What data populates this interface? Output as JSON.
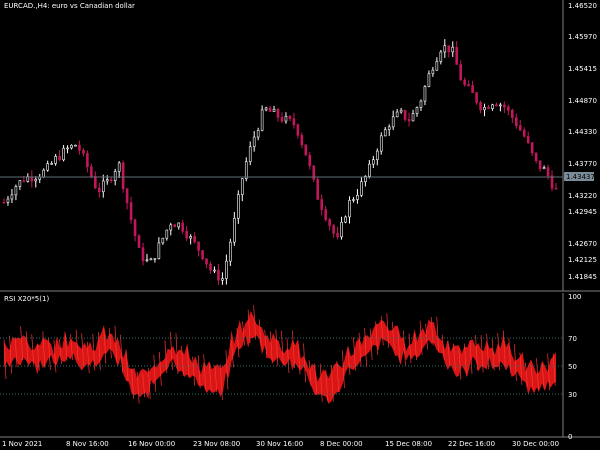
{
  "window": {
    "symbol_title": "EURCAD.,H4:  euro vs Canadian dollar",
    "indicator_title": "RSI X20*5(1)"
  },
  "colors": {
    "background": "#000000",
    "candle": "#ffffff",
    "candle_alt": "#c2185b",
    "axis_text": "#ffffff",
    "separator": "#808080",
    "rsi_fill": "#ff1a1a",
    "level_line": "#2e6f6f",
    "current_price_line": "#5f6f78",
    "price_marker_bg": "#7a8c99"
  },
  "price_axis": {
    "labels": [
      "1.46520",
      "1.45970",
      "1.45415",
      "1.44870",
      "1.44330",
      "1.43770",
      "1.43220",
      "1.42945",
      "1.42670",
      "1.42125",
      "1.41845"
    ],
    "current_price": "1.43437"
  },
  "rsi_axis": {
    "labels": [
      "100",
      "70",
      "50",
      "30",
      "0"
    ],
    "levels": [
      70,
      50,
      30
    ]
  },
  "time_axis": {
    "labels": [
      "1 Nov 2021",
      "8 Nov 16:00",
      "16 Nov 00:00",
      "23 Nov 08:00",
      "30 Nov 16:00",
      "8 Dec 00:00",
      "15 Dec 08:00",
      "22 Dec 16:00",
      "30 Dec 00:00"
    ]
  },
  "chart_data": {
    "type": "line",
    "title": "EURCAD.,H4:  euro vs Canadian dollar",
    "ylim": [
      1.417,
      1.4675
    ],
    "close_series": [
      {
        "t": 0,
        "v": 1.4325
      },
      {
        "t": 2,
        "v": 1.4352
      },
      {
        "t": 4,
        "v": 1.4368
      },
      {
        "t": 6,
        "v": 1.4372
      },
      {
        "t": 8,
        "v": 1.438
      },
      {
        "t": 10,
        "v": 1.4402
      },
      {
        "t": 12,
        "v": 1.4418
      },
      {
        "t": 14,
        "v": 1.4428
      },
      {
        "t": 16,
        "v": 1.4388
      },
      {
        "t": 18,
        "v": 1.4345
      },
      {
        "t": 20,
        "v": 1.4362
      },
      {
        "t": 22,
        "v": 1.4395
      },
      {
        "t": 24,
        "v": 1.431
      },
      {
        "t": 26,
        "v": 1.4235
      },
      {
        "t": 28,
        "v": 1.4215
      },
      {
        "t": 30,
        "v": 1.4252
      },
      {
        "t": 32,
        "v": 1.429
      },
      {
        "t": 34,
        "v": 1.4285
      },
      {
        "t": 36,
        "v": 1.4258
      },
      {
        "t": 38,
        "v": 1.4235
      },
      {
        "t": 40,
        "v": 1.42
      },
      {
        "t": 42,
        "v": 1.419
      },
      {
        "t": 44,
        "v": 1.428
      },
      {
        "t": 46,
        "v": 1.438
      },
      {
        "t": 48,
        "v": 1.444
      },
      {
        "t": 50,
        "v": 1.449
      },
      {
        "t": 52,
        "v": 1.448
      },
      {
        "t": 54,
        "v": 1.447
      },
      {
        "t": 56,
        "v": 1.4462
      },
      {
        "t": 58,
        "v": 1.441
      },
      {
        "t": 60,
        "v": 1.434
      },
      {
        "t": 62,
        "v": 1.4298
      },
      {
        "t": 64,
        "v": 1.4255
      },
      {
        "t": 66,
        "v": 1.432
      },
      {
        "t": 68,
        "v": 1.4345
      },
      {
        "t": 70,
        "v": 1.438
      },
      {
        "t": 72,
        "v": 1.443
      },
      {
        "t": 74,
        "v": 1.4465
      },
      {
        "t": 76,
        "v": 1.4482
      },
      {
        "t": 78,
        "v": 1.447
      },
      {
        "t": 80,
        "v": 1.4505
      },
      {
        "t": 82,
        "v": 1.456
      },
      {
        "t": 84,
        "v": 1.46
      },
      {
        "t": 86,
        "v": 1.4595
      },
      {
        "t": 88,
        "v": 1.4535
      },
      {
        "t": 90,
        "v": 1.4515
      },
      {
        "t": 92,
        "v": 1.449
      },
      {
        "t": 94,
        "v": 1.4505
      },
      {
        "t": 96,
        "v": 1.4495
      },
      {
        "t": 98,
        "v": 1.447
      },
      {
        "t": 100,
        "v": 1.444
      },
      {
        "t": 102,
        "v": 1.4395
      },
      {
        "t": 104,
        "v": 1.438
      },
      {
        "t": 106,
        "v": 1.4345
      }
    ],
    "rsi_series": [
      {
        "t": 0,
        "v": 52
      },
      {
        "t": 2,
        "v": 58
      },
      {
        "t": 4,
        "v": 62
      },
      {
        "t": 6,
        "v": 55
      },
      {
        "t": 8,
        "v": 60
      },
      {
        "t": 10,
        "v": 56
      },
      {
        "t": 12,
        "v": 64
      },
      {
        "t": 14,
        "v": 60
      },
      {
        "t": 16,
        "v": 52
      },
      {
        "t": 18,
        "v": 58
      },
      {
        "t": 20,
        "v": 66
      },
      {
        "t": 22,
        "v": 58
      },
      {
        "t": 24,
        "v": 40
      },
      {
        "t": 26,
        "v": 32
      },
      {
        "t": 28,
        "v": 38
      },
      {
        "t": 30,
        "v": 48
      },
      {
        "t": 32,
        "v": 58
      },
      {
        "t": 34,
        "v": 54
      },
      {
        "t": 36,
        "v": 46
      },
      {
        "t": 38,
        "v": 42
      },
      {
        "t": 40,
        "v": 38
      },
      {
        "t": 42,
        "v": 36
      },
      {
        "t": 44,
        "v": 62
      },
      {
        "t": 46,
        "v": 72
      },
      {
        "t": 48,
        "v": 76
      },
      {
        "t": 50,
        "v": 66
      },
      {
        "t": 52,
        "v": 60
      },
      {
        "t": 54,
        "v": 56
      },
      {
        "t": 56,
        "v": 58
      },
      {
        "t": 58,
        "v": 46
      },
      {
        "t": 60,
        "v": 36
      },
      {
        "t": 62,
        "v": 32
      },
      {
        "t": 64,
        "v": 38
      },
      {
        "t": 66,
        "v": 52
      },
      {
        "t": 68,
        "v": 56
      },
      {
        "t": 70,
        "v": 62
      },
      {
        "t": 72,
        "v": 72
      },
      {
        "t": 74,
        "v": 70
      },
      {
        "t": 76,
        "v": 62
      },
      {
        "t": 78,
        "v": 58
      },
      {
        "t": 80,
        "v": 66
      },
      {
        "t": 82,
        "v": 74
      },
      {
        "t": 84,
        "v": 62
      },
      {
        "t": 86,
        "v": 54
      },
      {
        "t": 88,
        "v": 50
      },
      {
        "t": 90,
        "v": 58
      },
      {
        "t": 92,
        "v": 56
      },
      {
        "t": 94,
        "v": 54
      },
      {
        "t": 96,
        "v": 58
      },
      {
        "t": 98,
        "v": 50
      },
      {
        "t": 100,
        "v": 42
      },
      {
        "t": 102,
        "v": 38
      },
      {
        "t": 104,
        "v": 42
      },
      {
        "t": 106,
        "v": 46
      }
    ]
  }
}
